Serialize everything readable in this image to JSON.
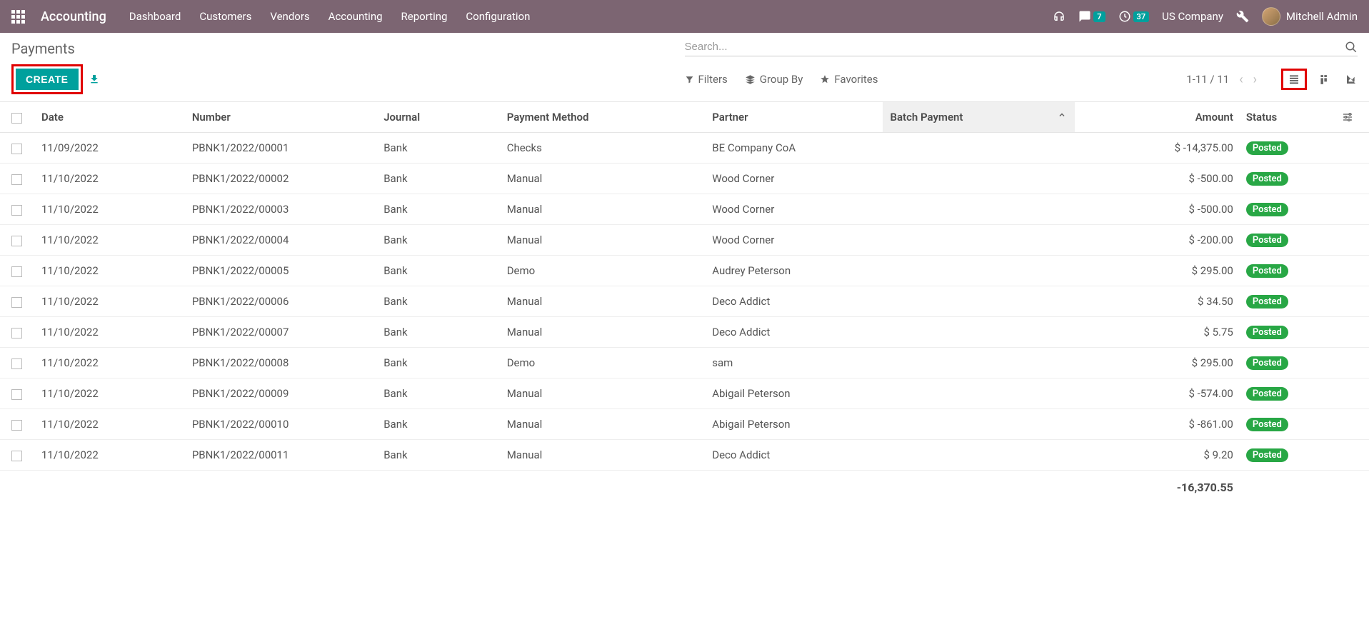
{
  "navbar": {
    "brand": "Accounting",
    "menu": [
      "Dashboard",
      "Customers",
      "Vendors",
      "Accounting",
      "Reporting",
      "Configuration"
    ],
    "messages_count": "7",
    "activities_count": "37",
    "company": "US Company",
    "user": "Mitchell Admin"
  },
  "page": {
    "title": "Payments",
    "create_label": "CREATE",
    "search_placeholder": "Search...",
    "filters_label": "Filters",
    "groupby_label": "Group By",
    "favorites_label": "Favorites",
    "pager": "1-11 / 11"
  },
  "table": {
    "headers": {
      "date": "Date",
      "number": "Number",
      "journal": "Journal",
      "payment_method": "Payment Method",
      "partner": "Partner",
      "batch_payment": "Batch Payment",
      "amount": "Amount",
      "status": "Status"
    },
    "rows": [
      {
        "date": "11/09/2022",
        "number": "PBNK1/2022/00001",
        "journal": "Bank",
        "method": "Checks",
        "partner": "BE Company CoA",
        "batch": "",
        "amount": "$ -14,375.00",
        "status": "Posted"
      },
      {
        "date": "11/10/2022",
        "number": "PBNK1/2022/00002",
        "journal": "Bank",
        "method": "Manual",
        "partner": "Wood Corner",
        "batch": "",
        "amount": "$ -500.00",
        "status": "Posted"
      },
      {
        "date": "11/10/2022",
        "number": "PBNK1/2022/00003",
        "journal": "Bank",
        "method": "Manual",
        "partner": "Wood Corner",
        "batch": "",
        "amount": "$ -500.00",
        "status": "Posted"
      },
      {
        "date": "11/10/2022",
        "number": "PBNK1/2022/00004",
        "journal": "Bank",
        "method": "Manual",
        "partner": "Wood Corner",
        "batch": "",
        "amount": "$ -200.00",
        "status": "Posted"
      },
      {
        "date": "11/10/2022",
        "number": "PBNK1/2022/00005",
        "journal": "Bank",
        "method": "Demo",
        "partner": "Audrey Peterson",
        "batch": "",
        "amount": "$ 295.00",
        "status": "Posted"
      },
      {
        "date": "11/10/2022",
        "number": "PBNK1/2022/00006",
        "journal": "Bank",
        "method": "Manual",
        "partner": "Deco Addict",
        "batch": "",
        "amount": "$ 34.50",
        "status": "Posted"
      },
      {
        "date": "11/10/2022",
        "number": "PBNK1/2022/00007",
        "journal": "Bank",
        "method": "Manual",
        "partner": "Deco Addict",
        "batch": "",
        "amount": "$ 5.75",
        "status": "Posted"
      },
      {
        "date": "11/10/2022",
        "number": "PBNK1/2022/00008",
        "journal": "Bank",
        "method": "Demo",
        "partner": "sam",
        "batch": "",
        "amount": "$ 295.00",
        "status": "Posted"
      },
      {
        "date": "11/10/2022",
        "number": "PBNK1/2022/00009",
        "journal": "Bank",
        "method": "Manual",
        "partner": "Abigail Peterson",
        "batch": "",
        "amount": "$ -574.00",
        "status": "Posted"
      },
      {
        "date": "11/10/2022",
        "number": "PBNK1/2022/00010",
        "journal": "Bank",
        "method": "Manual",
        "partner": "Abigail Peterson",
        "batch": "",
        "amount": "$ -861.00",
        "status": "Posted"
      },
      {
        "date": "11/10/2022",
        "number": "PBNK1/2022/00011",
        "journal": "Bank",
        "method": "Manual",
        "partner": "Deco Addict",
        "batch": "",
        "amount": "$ 9.20",
        "status": "Posted"
      }
    ],
    "total": "-16,370.55"
  }
}
